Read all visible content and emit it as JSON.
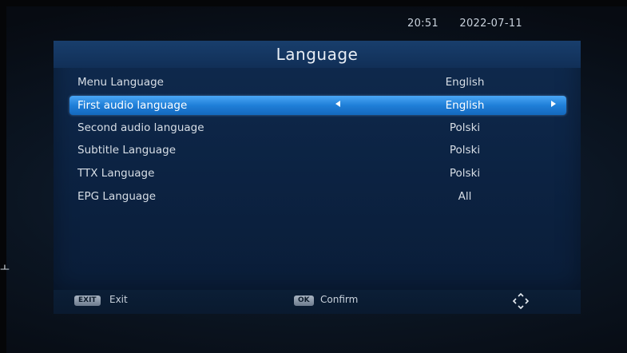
{
  "clock": {
    "time": "20:51",
    "date": "2022-07-11"
  },
  "panel": {
    "title": "Language",
    "rows": [
      {
        "label": "Menu Language",
        "value": "English"
      },
      {
        "label": "First audio language",
        "value": "English"
      },
      {
        "label": "Second audio language",
        "value": "Polski"
      },
      {
        "label": "Subtitle Language",
        "value": "Polski"
      },
      {
        "label": "TTX Language",
        "value": "Polski"
      },
      {
        "label": "EPG Language",
        "value": "All"
      }
    ],
    "selected_index": 1
  },
  "footer": {
    "exit_key": "EXIT",
    "exit_label": "Exit",
    "ok_key": "OK",
    "ok_label": "Confirm"
  },
  "edge_glyph": "ㅗ",
  "colors": {
    "highlight": "#1f7fd8",
    "panel": "#0c2343",
    "text": "#d7dee6"
  },
  "icons": {
    "nav": "direction-pad-icon"
  }
}
